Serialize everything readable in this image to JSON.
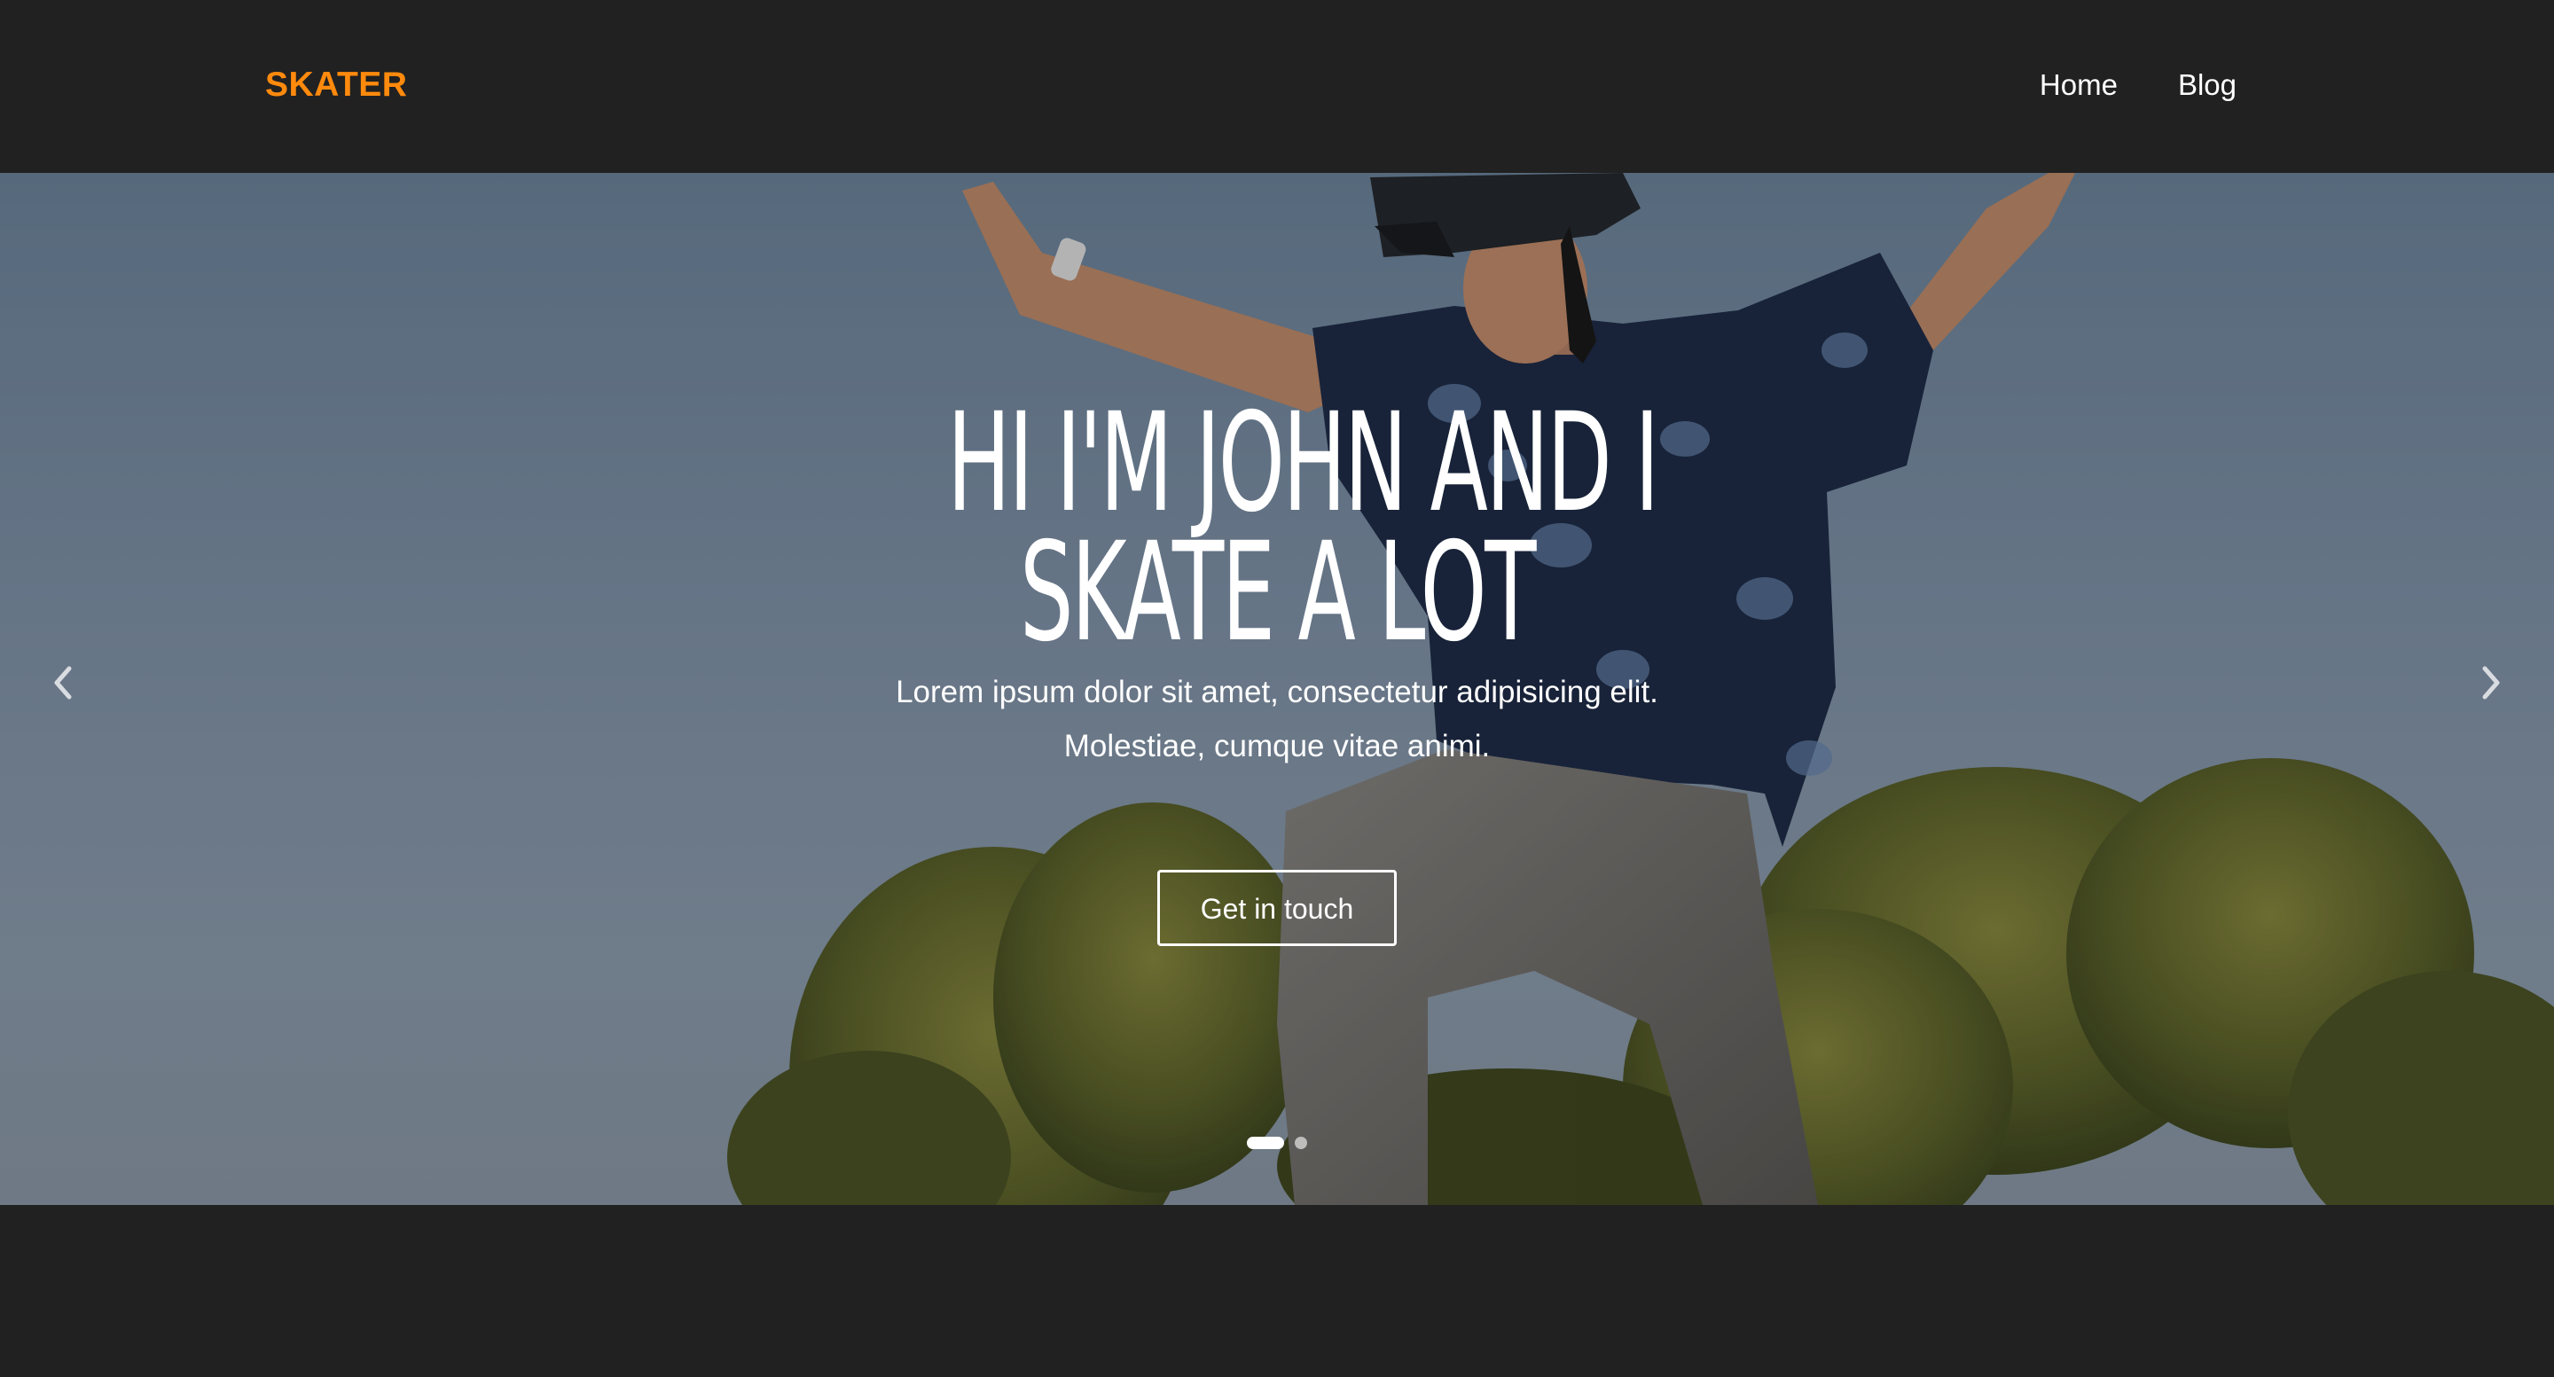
{
  "navbar": {
    "brand": "SKATER",
    "brand_color": "#ff8a0d",
    "links": [
      {
        "label": "Home"
      },
      {
        "label": "Blog"
      }
    ]
  },
  "hero": {
    "title_line1": "HI I'M JOHN AND I",
    "title_line2": "SKATE A LOT",
    "subtitle_line1": "Lorem ipsum dolor sit amet, consectetur adipisicing elit.",
    "subtitle_line2": "Molestiae, cumque vitae animi.",
    "cta_label": "Get in touch",
    "prev_icon": "chevron-left-icon",
    "next_icon": "chevron-right-icon",
    "slides_total": 2,
    "active_slide": 1
  },
  "colors": {
    "background": "#212121",
    "accent": "#ff8a0d",
    "text": "#ffffff"
  }
}
